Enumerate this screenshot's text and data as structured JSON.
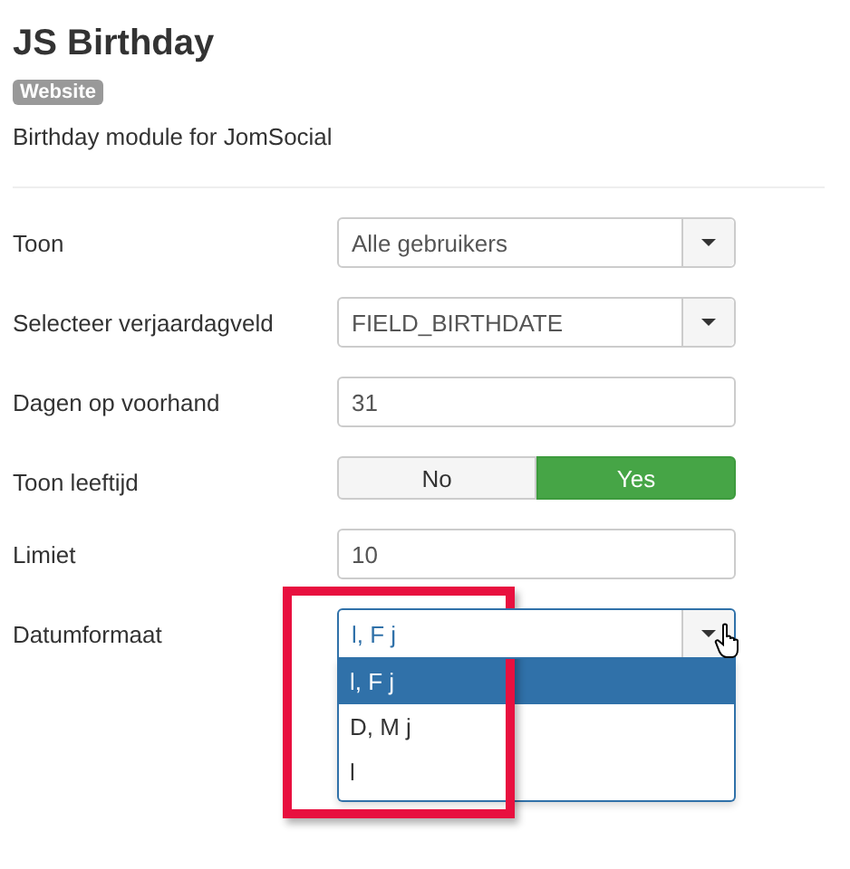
{
  "title": "JS Birthday",
  "badge": "Website",
  "description": "Birthday module for JomSocial",
  "fields": [
    {
      "kind": "select",
      "label": "Toon",
      "value": "Alle gebruikers"
    },
    {
      "kind": "select",
      "label": "Selecteer verjaardagveld",
      "value": "FIELD_BIRTHDATE"
    },
    {
      "kind": "text",
      "label": "Dagen op voorhand",
      "value": "31"
    },
    {
      "kind": "toggle",
      "label": "Toon leeftijd",
      "options": [
        {
          "label": "No",
          "selected": false
        },
        {
          "label": "Yes",
          "selected": true
        }
      ]
    },
    {
      "kind": "text",
      "label": "Limiet",
      "value": "10"
    },
    {
      "kind": "open-select",
      "label": "Datumformaat",
      "value": "l, F j",
      "highlighted": true,
      "cursor_on_caret": true,
      "options": [
        {
          "label": "l, F j",
          "selected": true
        },
        {
          "label": "D, M j",
          "selected": false
        },
        {
          "label": "l",
          "selected": false
        }
      ]
    }
  ]
}
